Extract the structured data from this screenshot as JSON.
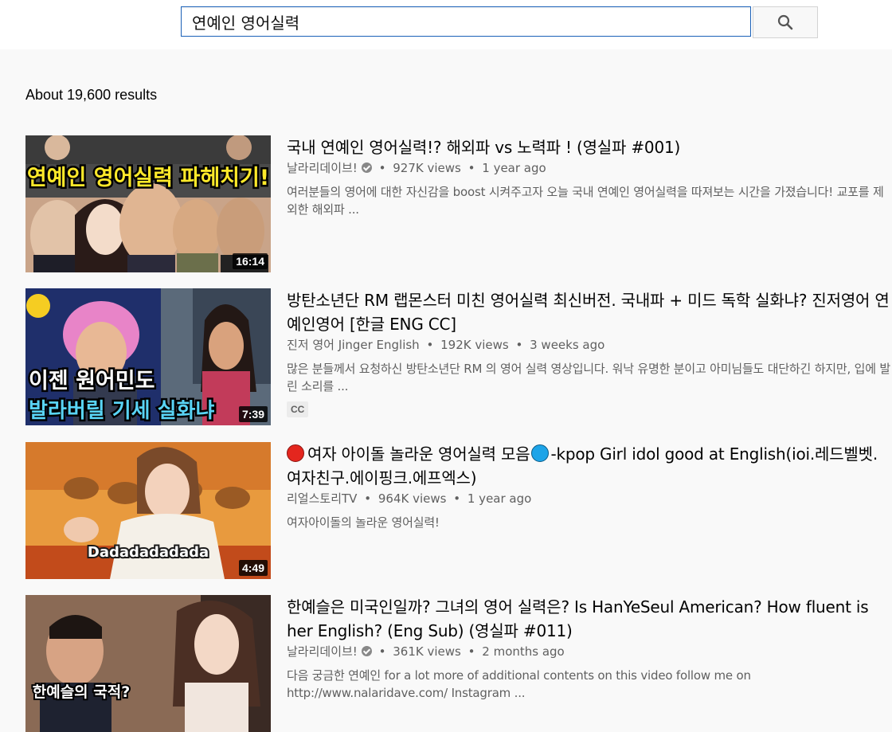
{
  "search": {
    "query": "연예인 영어실력",
    "button_icon": "search-icon"
  },
  "results_count": "About 19,600 results",
  "results": [
    {
      "title": "국내 연예인 영어실력!? 해외파 vs 노력파 ! (영실파 #001)",
      "channel": "날라리데이브!",
      "verified": true,
      "views": "927K views",
      "age": "1 year ago",
      "description": "여러분들의 영어에 대한 자신감을 boost 시켜주고자 오늘 국내 연예인 영어실력을 따져보는 시간을 가졌습니다! 교포를 제외한 해외파 ...",
      "duration": "16:14",
      "thumb_text": "연예인 영어실력 파헤치기!"
    },
    {
      "title": "방탄소년단 RM 랩몬스터 미친 영어실력 최신버전. 국내파 + 미드 독학 실화냐? 진저영어 연예인영어 [한글 ENG CC]",
      "channel": "진저 영어 Jinger English",
      "verified": false,
      "views": "192K views",
      "age": "3 weeks ago",
      "description": "많은 분들께서 요청하신 방탄소년단 RM 의 영어 실력 영상입니다. 워낙 유명한 분이고 아미님들도 대단하긴 하지만, 입에 발린 소리를 ...",
      "badge": "CC",
      "duration": "7:39",
      "thumb_text_1": "이젠 원어민도",
      "thumb_text_2": "발라버릴 기세 실화냐"
    },
    {
      "title_part1": "여자 아이돌 놀라운 영어실력 모음",
      "title_part2": "-kpop Girl idol good at English(ioi.레드벨벳.여자친구.에이핑크.에프엑스)",
      "channel": "리얼스토리TV",
      "verified": false,
      "views": "964K views",
      "age": "1 year ago",
      "description": "여자아이돌의 놀라운 영어실력!",
      "duration": "4:49",
      "thumb_text": "Dadadadadada"
    },
    {
      "title": "한예슬은 미국인일까? 그녀의 영어 실력은? Is HanYeSeul American? How fluent is her English? (Eng Sub) (영실파 #011)",
      "channel": "날라리데이브!",
      "verified": true,
      "views": "361K views",
      "age": "2 months ago",
      "description": "다음 궁금한 연예인 for a lot more of additional contents on this video follow me on http://www.nalaridave.com/ Instagram ...",
      "thumb_text": "한예슬의 국적?"
    }
  ]
}
